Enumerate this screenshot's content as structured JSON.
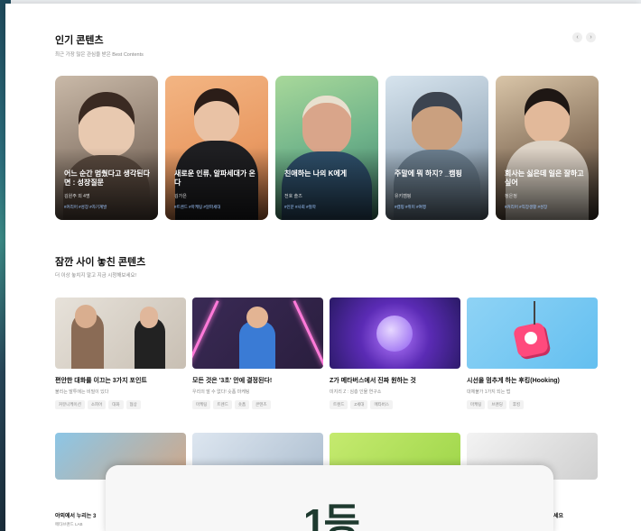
{
  "popular": {
    "title": "인기 콘텐츠",
    "subtitle": "최근 가장 많은 관심을 받은 Best Contents",
    "prev_icon": "chevron-left-icon",
    "next_icon": "chevron-right-icon",
    "cards": [
      {
        "title": "어느 순간 멈췄다고 생각된다면 : 성장질문",
        "author": "김원주 외 4명",
        "tags": "#커리어 #성장 #자기계발"
      },
      {
        "title": "새로운 인류, 알파세대가 온다",
        "author": "김가은",
        "tags": "#트렌드 #마케팅 #알파세대"
      },
      {
        "title": "친애하는 나의 K에게",
        "author": "전호 솔즈",
        "tags": "#인문 #사회 #철학"
      },
      {
        "title": "주말에 뭐 하지? _캠핑",
        "author": "유키캠핑",
        "tags": "#캠핑 #취미 #여행"
      },
      {
        "title": "회사는 싫은데 일은 잘하고 싶어",
        "author": "정은정",
        "tags": "#커리어 #직장생활 #성장"
      }
    ]
  },
  "missed": {
    "title": "잠깐 사이 놓친 콘텐츠",
    "subtitle": "더 이상 놓치지 말고 지금 시청해보세요!",
    "cards": [
      {
        "title": "편안한 대화를 이끄는 3가지 포인트",
        "sub": "불리는 말투에는 비밀이 있다",
        "tags": [
          "커뮤니케이션",
          "소피어",
          "대화",
          "협상"
        ]
      },
      {
        "title": "모든 것은 '3초' 안에 결정된다!",
        "sub": "우리의 말 수 없다! 숏폼 마케팅",
        "tags": [
          "마케팅",
          "트렌드",
          "숏폼",
          "콘텐츠"
        ]
      },
      {
        "title": "Z가 메타버스에서 진짜 원하는 것",
        "sub": "미지리 Z : 심층 인물 연구소",
        "tags": [
          "트렌드",
          "Z세대",
          "메타버스"
        ]
      },
      {
        "title": "시선을 멈추게 하는 후킹(Hooking)",
        "sub": "대체불가 1가지 되는 법",
        "tags": [
          "마케팅",
          "브랜딩",
          "후킹"
        ]
      }
    ]
  },
  "row3": [
    {
      "title": "야외에서 누리는 3",
      "sub": "메타브랜드 LAB"
    },
    {
      "title": "",
      "sub": ""
    },
    {
      "title": "",
      "sub": ""
    },
    {
      "title": "세요",
      "sub": ""
    }
  ],
  "overlay": {
    "rank": "1등"
  }
}
